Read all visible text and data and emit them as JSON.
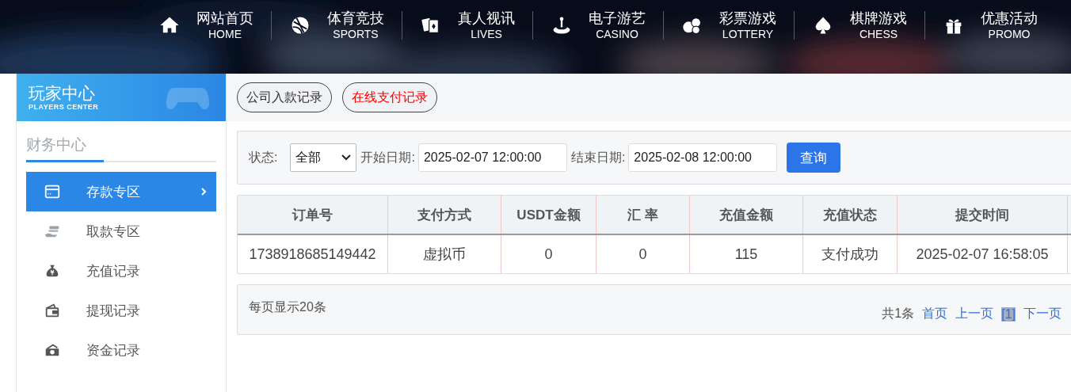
{
  "nav": [
    {
      "kind": "home",
      "title": "网站首页",
      "subtitle": "HOME"
    },
    {
      "kind": "sports",
      "title": "体育竞技",
      "subtitle": "SPORTS"
    },
    {
      "kind": "lives",
      "title": "真人视讯",
      "subtitle": "LIVES"
    },
    {
      "kind": "casino",
      "title": "电子游艺",
      "subtitle": "CASINO"
    },
    {
      "kind": "lottery",
      "title": "彩票游戏",
      "subtitle": "LOTTERY"
    },
    {
      "kind": "chess",
      "title": "棋牌游戏",
      "subtitle": "CHESS"
    },
    {
      "kind": "promo",
      "title": "优惠活动",
      "subtitle": "PROMO"
    }
  ],
  "sidebar": {
    "title": "玩家中心",
    "subtitle": "PLAYERS CENTER",
    "section": "财务中心",
    "items": [
      {
        "kind": "card",
        "label": "存款专区",
        "selected": true
      },
      {
        "kind": "hand",
        "label": "取款专区",
        "selected": false
      },
      {
        "kind": "bag",
        "label": "充值记录",
        "selected": false
      },
      {
        "kind": "wallet",
        "label": "提现记录",
        "selected": false
      },
      {
        "kind": "cash",
        "label": "资金记录",
        "selected": false
      }
    ]
  },
  "tabs": [
    {
      "label": "公司入款记录",
      "selected": false
    },
    {
      "label": "在线支付记录",
      "selected": true
    }
  ],
  "filter": {
    "status_label": "状态:",
    "status_value": "全部",
    "start_label": "开始日期:",
    "start_value": "2025-02-07 12:00:00",
    "end_label": "结束日期:",
    "end_value": "2025-02-08 12:00:00",
    "button": "查询"
  },
  "table": {
    "columns": [
      "订单号",
      "支付方式",
      "USDT金额",
      "汇 率",
      "充值金额",
      "充值状态",
      "提交时间"
    ],
    "rows": [
      [
        "1738918685149442",
        "虚拟币",
        "0",
        "0",
        "115",
        "支付成功",
        "2025-02-07 16:58:05"
      ]
    ]
  },
  "pagination": {
    "per_page": "每页显示20条",
    "total": "共1条",
    "links": [
      {
        "label": "首页",
        "selected": false
      },
      {
        "label": "上一页",
        "selected": false
      },
      {
        "label": "[1]",
        "selected": true
      },
      {
        "label": "下一页",
        "selected": false
      }
    ]
  }
}
